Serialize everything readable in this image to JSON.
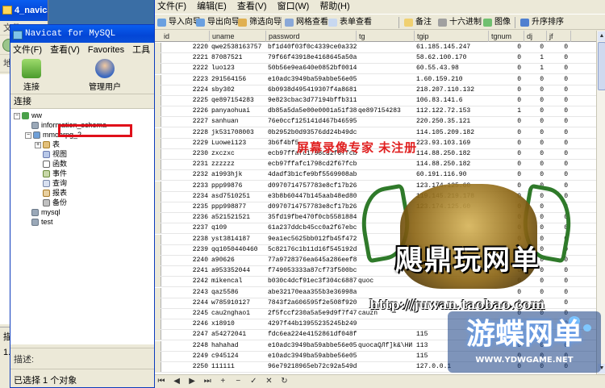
{
  "explorer": {
    "title": "4_navicat",
    "menu": "文件(F)",
    "back": "后退",
    "address": "地址(D)",
    "desc": "描述: Navi",
    "size": "1.8"
  },
  "navicat": {
    "title": "Navicat for MySQL",
    "menu": [
      "文件(F)",
      "查看(V)",
      "Favorites",
      "工具"
    ],
    "tools": [
      "连接",
      "管理用户"
    ],
    "conn_header": "连接",
    "tree": {
      "root": "ww",
      "dbs": [
        "information_schema",
        "mmoarpg_2"
      ],
      "objects": [
        "表",
        "视图",
        "函数",
        "事件",
        "查询",
        "报表",
        "备份"
      ],
      "others": [
        "mysql",
        "test"
      ]
    },
    "desc": "描述:",
    "status": "已选择 1 个对象"
  },
  "main": {
    "menu": [
      "文件(F)",
      "编辑(E)",
      "查看(V)",
      "窗口(W)",
      "帮助(H)"
    ],
    "toolbar": [
      "导入向导",
      "导出向导",
      "筛选向导",
      "网格查看",
      "表单查看",
      "备注",
      "十六进制",
      "图像",
      "升序排序"
    ],
    "columns": [
      "id",
      "uname",
      "password",
      "tg",
      "tgip",
      "tgnum",
      "dj",
      "jf"
    ],
    "rows": [
      [
        "2220",
        "qwe2538163757",
        "bf1d40f03f0c4339ce0a3328",
        "",
        "61.185.145.247",
        "0",
        "0",
        "0"
      ],
      [
        "2221",
        "87087521",
        "79f66f43918e4168645a50a8",
        "",
        "58.62.100.170",
        "0",
        "1",
        "0"
      ],
      [
        "2222",
        "luo123",
        "50b56e9ea640e0852bf00143",
        "",
        "60.55.43.98",
        "0",
        "1",
        "0"
      ],
      [
        "2223",
        "291564156",
        "e10adc3949ba59abbe56e057",
        "",
        "1.60.159.210",
        "0",
        "0",
        "0"
      ],
      [
        "2224",
        "sby302",
        "6b0938d495419307f4a8681",
        "",
        "218.207.110.132",
        "0",
        "0",
        "0"
      ],
      [
        "2225",
        "qe897154283",
        "9e823cbac3d77194bffb3113",
        "",
        "106.83.141.6",
        "0",
        "0",
        "0"
      ],
      [
        "2226",
        "panyaohuai",
        "db85a5da5e00e0001a51f38a",
        "qe897154283",
        "112.122.72.153",
        "1",
        "0",
        "0"
      ],
      [
        "2227",
        "sanhuan",
        "76e0ccf125141d467b465951",
        "",
        "220.250.35.121",
        "0",
        "0",
        "0"
      ],
      [
        "2228",
        "jk531708003",
        "0b2952b0d93576dd24b49dcb",
        "",
        "114.105.209.182",
        "0",
        "0",
        "0"
      ],
      [
        "2229",
        "Luowei123",
        "3b6f4bf5",
        "",
        "223.93.103.169",
        "0",
        "0",
        "0"
      ],
      [
        "2230",
        "zxczxc",
        "ecb97ffafc1798cd2f67fcbc",
        "",
        "114.88.250.182",
        "0",
        "0",
        "0"
      ],
      [
        "2231",
        "zzzzzz",
        "ecb97ffafc1798cd2f67fcbc",
        "",
        "114.88.250.182",
        "0",
        "0",
        "0"
      ],
      [
        "2232",
        "a1993hjk",
        "4dadf3b1cfe9bf5569908ab1",
        "",
        "60.191.116.90",
        "0",
        "0",
        "0"
      ],
      [
        "2233",
        "ppp99876",
        "d0970714757783e8cf17b26f",
        "",
        "123.174.125.60",
        "0",
        "0",
        "0"
      ],
      [
        "2234",
        "asd7510251",
        "e3b8b60447b145aab48ed804",
        "",
        "119.145.219.178",
        "0",
        "0",
        "0"
      ],
      [
        "2235",
        "ppp998877",
        "d0970714757783e8cf17b26f",
        "",
        "123.174.125.60",
        "0",
        "0",
        "0"
      ],
      [
        "2236",
        "a521521521",
        "35fd19fbe470f0cb5581884f",
        "",
        "",
        "0",
        "0",
        "0"
      ],
      [
        "2237",
        "q109",
        "61a237ddcb45cc0a2f67ebc8",
        "",
        "",
        "0",
        "0",
        "0"
      ],
      [
        "2238",
        "yst3814187",
        "9ea1ec5625bb012fb45f472d",
        "",
        "",
        "0",
        "0",
        "0"
      ],
      [
        "2239",
        "qq1050440460",
        "5c82176c1b11d16f545192da",
        "",
        "",
        "0",
        "0",
        "0"
      ],
      [
        "2240",
        "a90626",
        "77a9728376ea645a286eef8a",
        "",
        "",
        "0",
        "0",
        "0"
      ],
      [
        "2241",
        "a953352044",
        "f749053333a87cf73f500bc3",
        "",
        "",
        "0",
        "0",
        "0"
      ],
      [
        "2242",
        "mikencal",
        "b030c4dcf91ec3f304c6887c",
        "quoc",
        "",
        "0",
        "0",
        "0"
      ],
      [
        "2243",
        "qaz5586",
        "abe32170eaa355b3e36998a1",
        "",
        "",
        "0",
        "0",
        "0"
      ],
      [
        "2244",
        "w785910127",
        "7843f2a606595f2e508f9205",
        "",
        "",
        "0",
        "0",
        "0"
      ],
      [
        "2245",
        "cau2nghao1",
        "2f5fccf230a5a5e9d9f7f47f",
        "cauzn",
        "",
        "0",
        "0",
        "0"
      ],
      [
        "2246",
        "x18910",
        "4297f44b13955235245b2497",
        "",
        "",
        "0",
        "0",
        "0"
      ],
      [
        "2247",
        "a54272041",
        "fdc6ea224e4152861df048fc",
        "",
        "115",
        "0",
        "0",
        "0"
      ],
      [
        "2248",
        "hahahad",
        "e10adc3949ba59abbe56e057",
        "quocaQЛf]k&\\HИ",
        "113",
        "0",
        "0",
        "0"
      ],
      [
        "2249",
        "c945124",
        "e10adc3949ba59abbe56e057",
        "",
        "115",
        "0",
        "0",
        "0"
      ],
      [
        "2250",
        "111111",
        "96e79218965eb72c92a549dd",
        "",
        "127.0.0.1",
        "0",
        "0",
        "0"
      ]
    ],
    "watermark": "屏幕录像专家 未注册",
    "brand": "飓鼎玩网单",
    "url": "http://juwan.taobao.com",
    "game_site": "游蝶网单",
    "game_url": "WWW.YDWGAME.NET"
  }
}
